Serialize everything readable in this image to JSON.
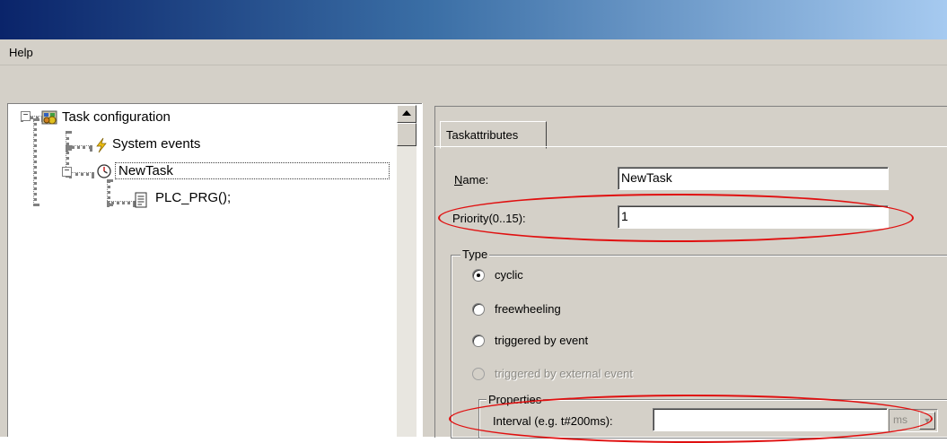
{
  "menu": {
    "help_label": "Help"
  },
  "tree": {
    "root": {
      "label": "Task configuration",
      "icon": "task-config-icon"
    },
    "system_events": {
      "label": "System events",
      "icon": "lightning-icon"
    },
    "task": {
      "label": "NewTask",
      "icon": "clock-icon"
    },
    "program": {
      "label": "PLC_PRG();",
      "icon": "document-icon"
    }
  },
  "tab": {
    "label": "Taskattributes"
  },
  "form": {
    "name_label": "Name:",
    "name_value": "NewTask",
    "priority_label": "Priority(0..15):",
    "priority_value": "1",
    "type_group_label": "Type",
    "type_options": [
      {
        "label": "cyclic",
        "selected": true,
        "enabled": true
      },
      {
        "label": "freewheeling",
        "selected": false,
        "enabled": true
      },
      {
        "label": "triggered by event",
        "selected": false,
        "enabled": true
      },
      {
        "label": "triggered by external event",
        "selected": false,
        "enabled": false
      }
    ],
    "properties_group_label": "Properties",
    "interval_label": "Interval (e.g. t#200ms):",
    "interval_value": "",
    "interval_unit": "ms"
  },
  "colors": {
    "annotation": "#e01010",
    "window_face": "#d4d0c8",
    "titlebar_start": "#0a246a"
  }
}
